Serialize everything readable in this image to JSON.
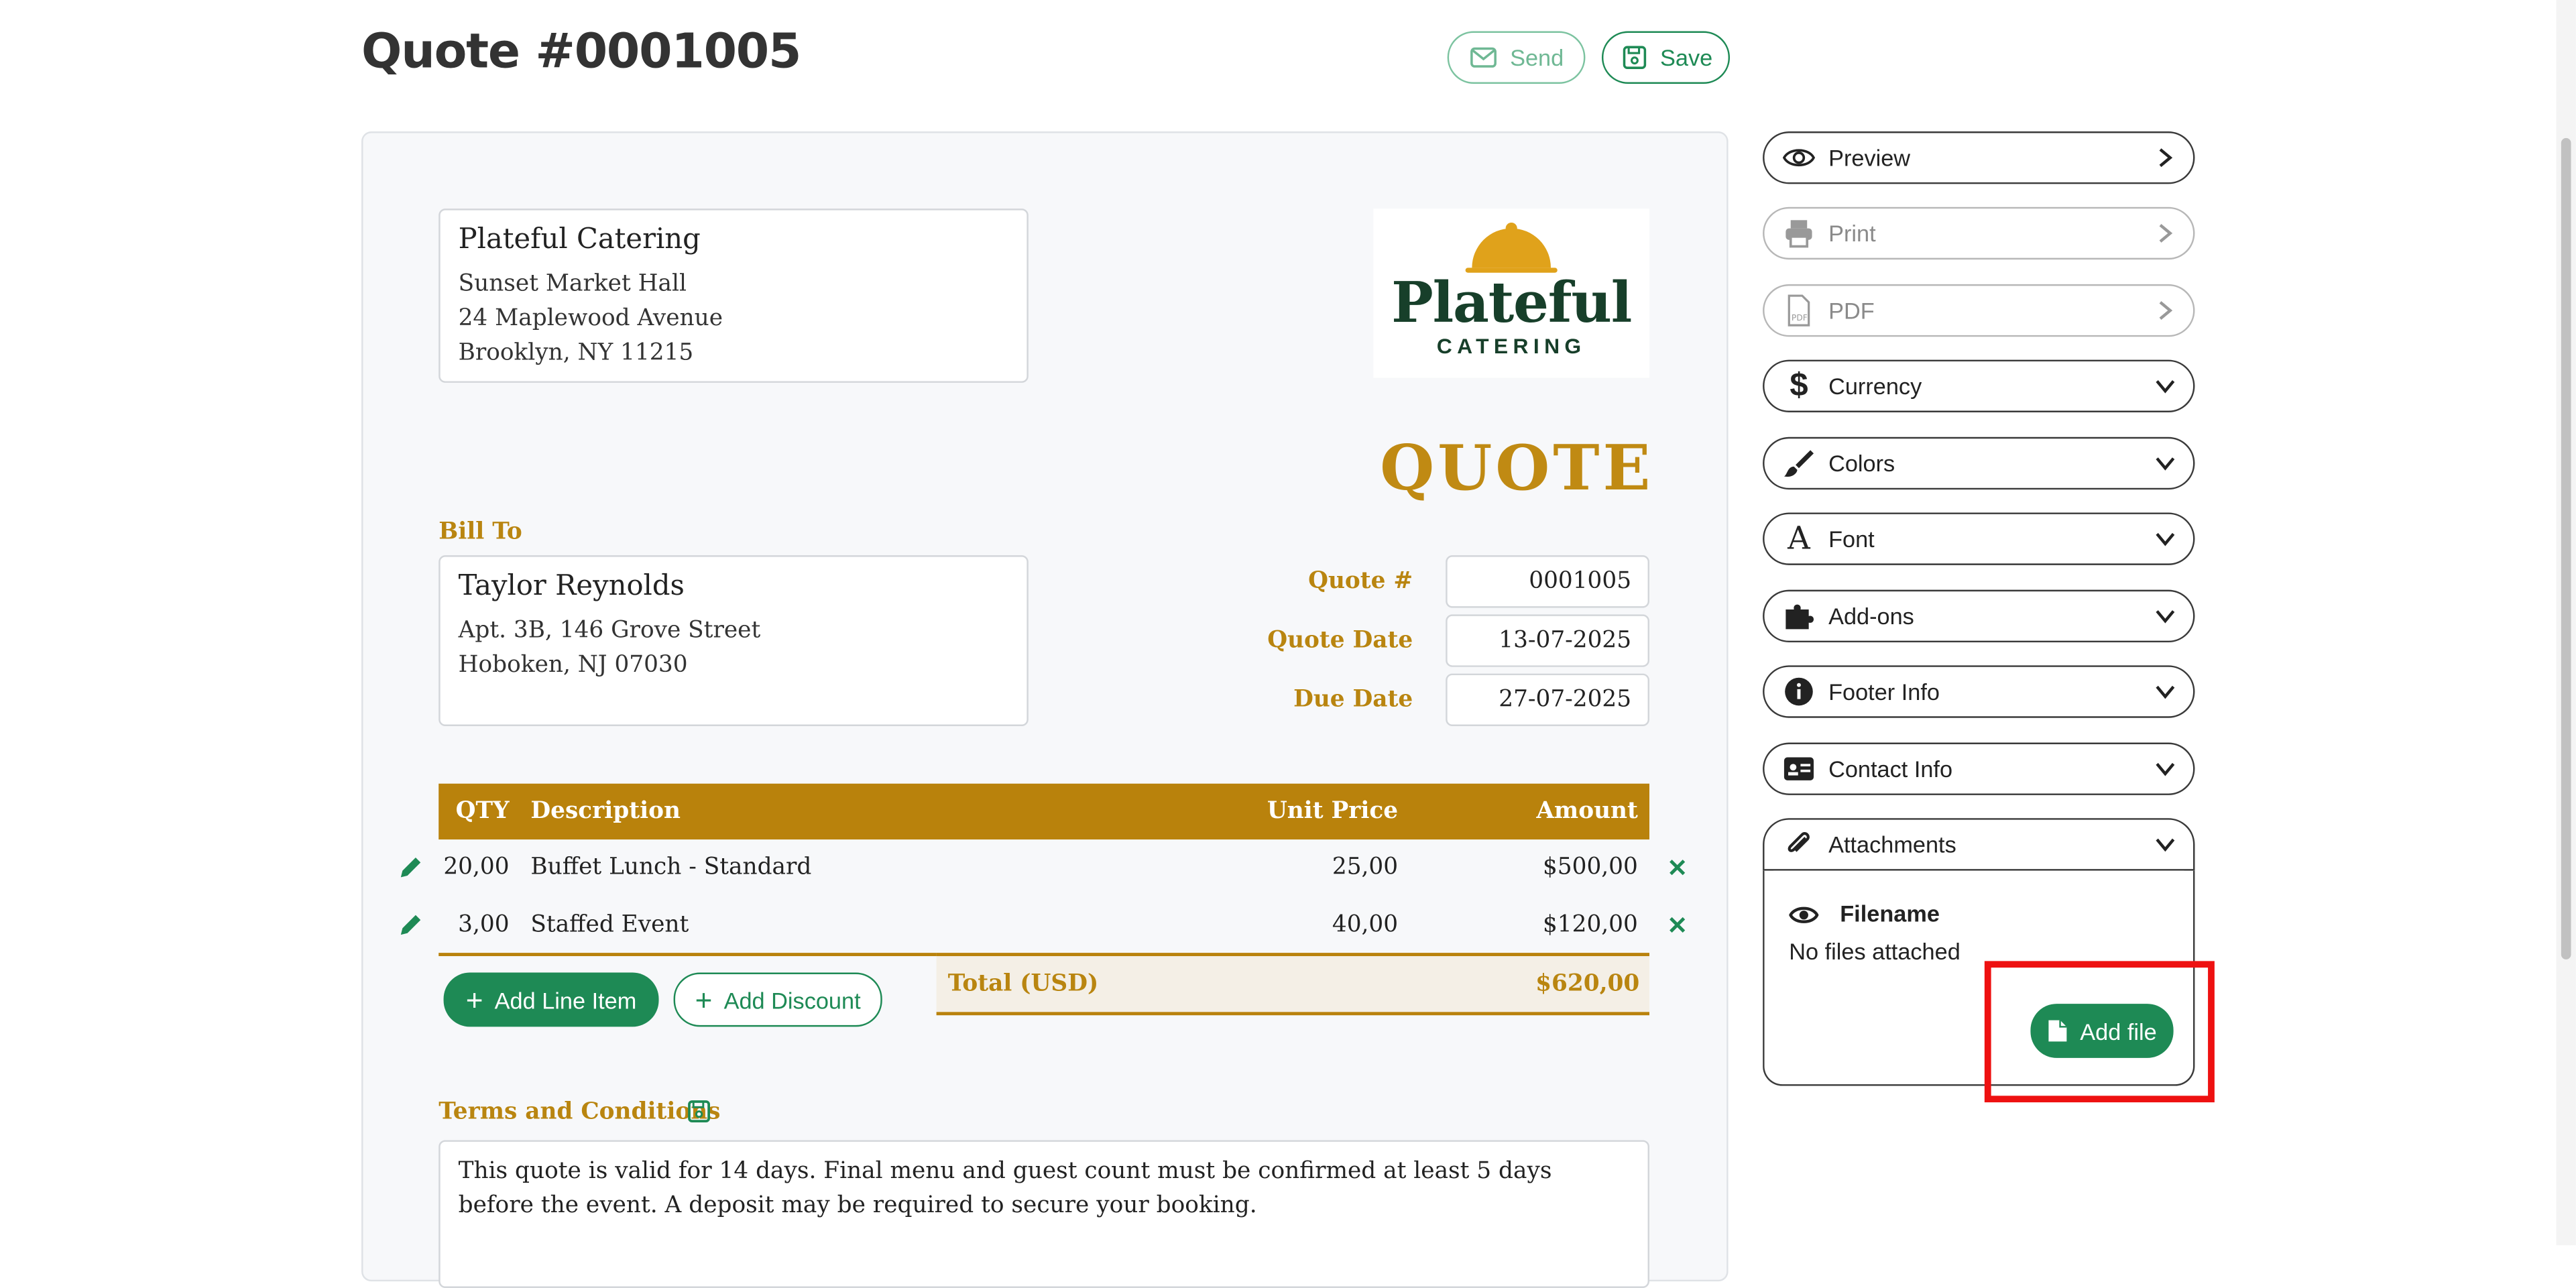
{
  "header": {
    "title": "Quote #0001005",
    "send_label": "Send",
    "save_label": "Save"
  },
  "from": {
    "company": "Plateful Catering",
    "line1": "Sunset Market Hall",
    "line2": "24 Maplewood Avenue",
    "line3": "Brooklyn, NY 11215"
  },
  "logo": {
    "word": "Plateful",
    "sub": "CATERING"
  },
  "doc_type": "QUOTE",
  "bill_to": {
    "label": "Bill To",
    "name": "Taylor Reynolds",
    "line1": "Apt. 3B, 146 Grove Street",
    "line2": "Hoboken, NJ 07030"
  },
  "meta": {
    "quote_no_label": "Quote #",
    "quote_no": "0001005",
    "quote_date_label": "Quote Date",
    "quote_date": "13-07-2025",
    "due_date_label": "Due Date",
    "due_date": "27-07-2025"
  },
  "table": {
    "headers": {
      "qty": "QTY",
      "description": "Description",
      "unit_price": "Unit Price",
      "amount": "Amount"
    },
    "rows": [
      {
        "qty": "20,00",
        "description": "Buffet Lunch - Standard",
        "unit_price": "25,00",
        "amount": "$500,00"
      },
      {
        "qty": "3,00",
        "description": "Staffed Event",
        "unit_price": "40,00",
        "amount": "$120,00"
      }
    ],
    "total_label": "Total (USD)",
    "total_value": "$620,00"
  },
  "actions": {
    "add_line_item": "Add Line Item",
    "add_discount": "Add Discount"
  },
  "terms": {
    "label": "Terms and Conditions",
    "text": "This quote is valid for 14 days. Final menu and guest count must be confirmed at least 5 days before the event. A deposit may be required to secure your booking."
  },
  "sidebar": {
    "items": [
      {
        "label": "Preview"
      },
      {
        "label": "Print"
      },
      {
        "label": "PDF"
      },
      {
        "label": "Currency"
      },
      {
        "label": "Colors"
      },
      {
        "label": "Font"
      },
      {
        "label": "Add-ons"
      },
      {
        "label": "Footer Info"
      },
      {
        "label": "Contact Info"
      },
      {
        "label": "Attachments"
      }
    ],
    "attachments": {
      "filename_header": "Filename",
      "empty_text": "No files attached",
      "add_file_label": "Add file"
    }
  },
  "colors": {
    "accent_gold": "#b9820c",
    "green": "#1e8a55",
    "highlight": "#ee1111"
  }
}
